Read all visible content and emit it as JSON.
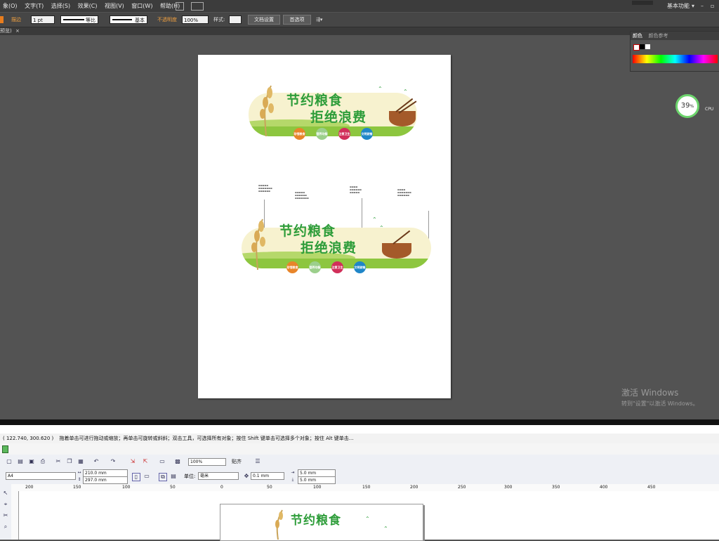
{
  "illustrator": {
    "menu": [
      "象(O)",
      "文字(T)",
      "选择(S)",
      "效果(C)",
      "视图(V)",
      "窗口(W)",
      "帮助(H)"
    ],
    "workspace": "基本功能",
    "control": {
      "stroke_label": "描边",
      "stroke_weight": "1 pt",
      "stroke_profile": "等比",
      "brush": "基本",
      "opacity_label": "不透明度",
      "opacity": "100%",
      "style_label": "样式:",
      "doc_setup": "文档设置",
      "prefs": "首选项"
    },
    "doc_tab": "预览)",
    "color_panel": {
      "tab1": "颜色",
      "tab2": "颜色参考"
    },
    "cpu": {
      "percent": "39",
      "unit": "%",
      "label": "CPU"
    },
    "activation": {
      "line1": "激活 Windows",
      "line2": "转到\"设置\"以激活 Windows。"
    }
  },
  "artwork": {
    "title1": "节约粮食",
    "title2": "拒绝浪费",
    "circles": [
      {
        "text": "珍惜粮食",
        "color": "#e8852a"
      },
      {
        "text": "营养均衡",
        "color": "#9ccf8c"
      },
      {
        "text": "注意卫生",
        "color": "#d12f5a"
      },
      {
        "text": "文明就餐",
        "color": "#1f86c8"
      }
    ]
  },
  "corel": {
    "coords": "( 122.740, 300.620 )",
    "hint": "拖着单击可进行拖动或缩放；再单击可旋转或斜斜；双击工具，可选择所有对象；按住 Shift 键单击可选择多个对象；按住 Alt 键单击...",
    "zoom": "100%",
    "snap": "贴齐",
    "page_size": "A4",
    "width": "210.0 mm",
    "height": "297.0 mm",
    "unit_label": "单位:",
    "unit": "毫米",
    "nudge": "0.1 mm",
    "dup_x": "5.0 mm",
    "dup_y": "5.0 mm",
    "ruler_ticks": [
      "200",
      "150",
      "100",
      "50",
      "0",
      "50",
      "100",
      "150",
      "200",
      "250",
      "300",
      "350",
      "400",
      "450"
    ]
  }
}
